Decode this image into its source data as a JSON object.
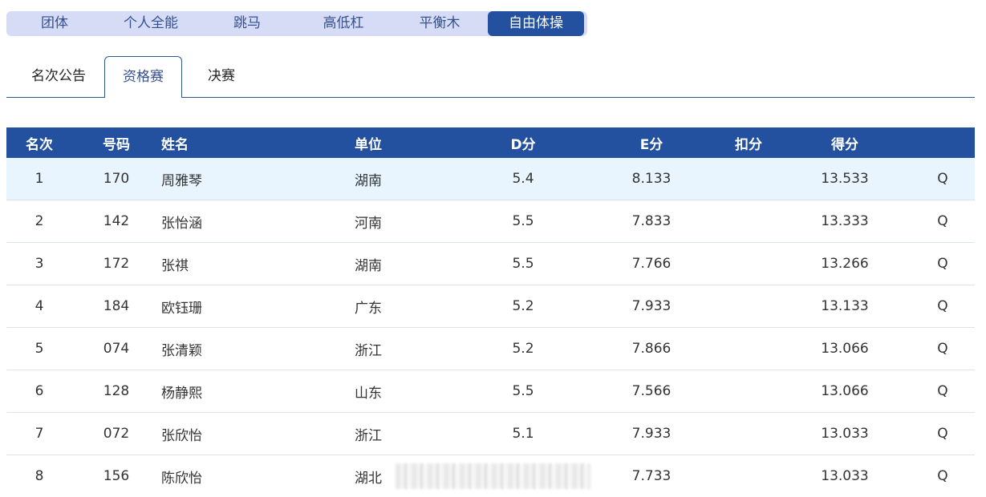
{
  "apparatus_tabs": [
    "团体",
    "个人全能",
    "跳马",
    "高低杠",
    "平衡木",
    "自由体操"
  ],
  "active_apparatus": "自由体操",
  "stage_tabs": [
    "名次公告",
    "资格赛",
    "决赛"
  ],
  "active_stage": "资格赛",
  "table": {
    "headers": {
      "rank": "名次",
      "number": "号码",
      "name": "姓名",
      "unit": "单位",
      "d": "D分",
      "e": "E分",
      "deduction": "扣分",
      "total": "得分"
    },
    "rows": [
      {
        "rank": "1",
        "number": "170",
        "name": "周雅琴",
        "unit": "湖南",
        "d": "5.4",
        "e": "8.133",
        "deduction": "",
        "total": "13.533",
        "q": "Q"
      },
      {
        "rank": "2",
        "number": "142",
        "name": "张怡涵",
        "unit": "河南",
        "d": "5.5",
        "e": "7.833",
        "deduction": "",
        "total": "13.333",
        "q": "Q"
      },
      {
        "rank": "3",
        "number": "172",
        "name": "张祺",
        "unit": "湖南",
        "d": "5.5",
        "e": "7.766",
        "deduction": "",
        "total": "13.266",
        "q": "Q"
      },
      {
        "rank": "4",
        "number": "184",
        "name": "欧钰珊",
        "unit": "广东",
        "d": "5.2",
        "e": "7.933",
        "deduction": "",
        "total": "13.133",
        "q": "Q"
      },
      {
        "rank": "5",
        "number": "074",
        "name": "张清颖",
        "unit": "浙江",
        "d": "5.2",
        "e": "7.866",
        "deduction": "",
        "total": "13.066",
        "q": "Q"
      },
      {
        "rank": "6",
        "number": "128",
        "name": "杨静熙",
        "unit": "山东",
        "d": "5.5",
        "e": "7.566",
        "deduction": "",
        "total": "13.066",
        "q": "Q"
      },
      {
        "rank": "7",
        "number": "072",
        "name": "张欣怡",
        "unit": "浙江",
        "d": "5.1",
        "e": "7.933",
        "deduction": "",
        "total": "13.033",
        "q": "Q"
      },
      {
        "rank": "8",
        "number": "156",
        "name": "陈欣怡",
        "unit": "湖北",
        "d": "",
        "e": "7.733",
        "deduction": "",
        "total": "13.033",
        "q": "Q"
      }
    ]
  }
}
